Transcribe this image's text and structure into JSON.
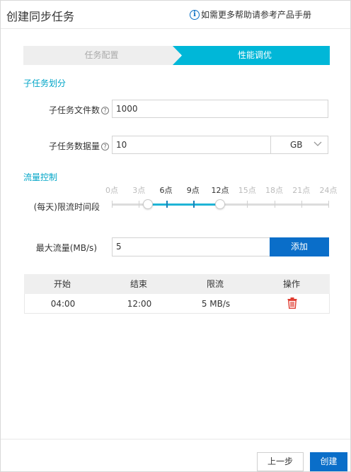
{
  "dialog": {
    "title": "创建同步任务",
    "help_text": "如需更多帮助请参考产品手册",
    "help_icon": "info-icon"
  },
  "steps": [
    {
      "label": "任务配置",
      "active": false
    },
    {
      "label": "性能调优",
      "active": true
    }
  ],
  "subtask": {
    "section_title": "子任务划分",
    "file_count": {
      "label": "子任务文件数",
      "value": "1000"
    },
    "data_size": {
      "label": "子任务数据量",
      "value": "10",
      "unit": "GB"
    }
  },
  "flow": {
    "section_title": "流量控制",
    "time_label": "(每天)限流时间段",
    "ticks": [
      "0点",
      "3点",
      "6点",
      "9点",
      "12点",
      "15点",
      "18点",
      "21点",
      "24点"
    ],
    "range_start_hour": 4,
    "range_end_hour": 12,
    "max_label": "最大流量(MB/s)",
    "max_value": "5",
    "add_button": "添加"
  },
  "table": {
    "headers": [
      "开始",
      "结束",
      "限流",
      "操作"
    ],
    "rows": [
      {
        "start": "04:00",
        "end": "12:00",
        "limit": "5 MB/s",
        "action_icon": "trash-icon"
      }
    ]
  },
  "footer": {
    "prev_button": "上一步",
    "create_button": "创建"
  },
  "colors": {
    "accent": "#00b7d8",
    "primary": "#0a6ec9",
    "danger": "#e03c31"
  }
}
